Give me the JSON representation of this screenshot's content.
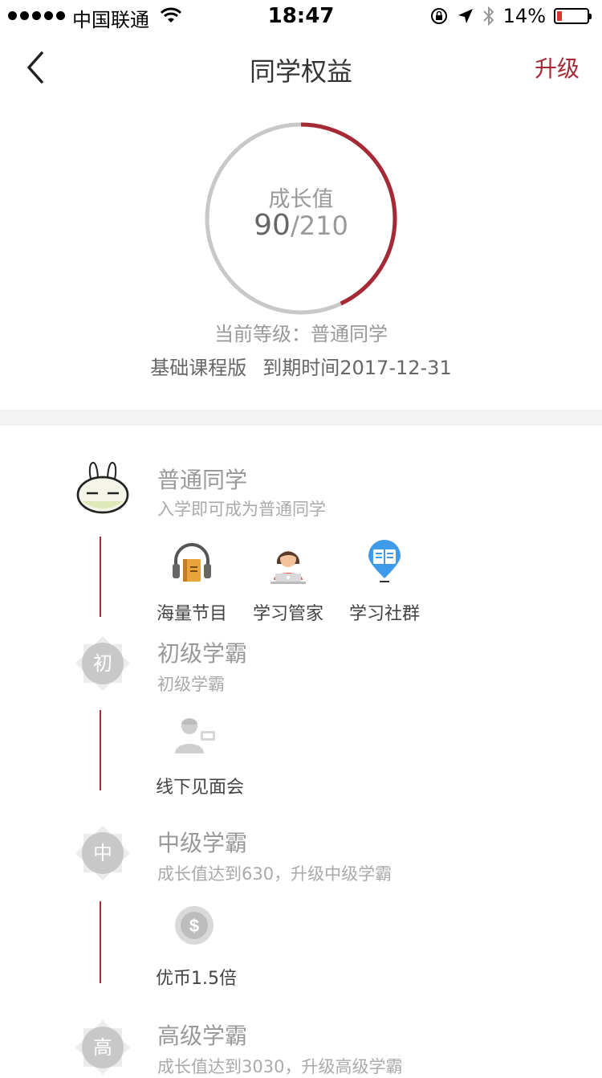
{
  "status_bar": {
    "carrier": "中国联通",
    "time": "18:47",
    "battery_percent": "14%",
    "battery_level": 0.14
  },
  "nav": {
    "title": "同学权益",
    "upgrade_label": "升级"
  },
  "progress": {
    "label": "成长值",
    "current": "90",
    "total": "/210",
    "fraction": 0.43,
    "accent_color": "#a52a35",
    "track_color": "#c8c8c8"
  },
  "current_level": "当前等级：普通同学",
  "plan": {
    "edition": "基础课程版",
    "expiry": "到期时间2017-12-31"
  },
  "tiers": [
    {
      "name": "普通同学",
      "desc": "入学即可成为普通同学",
      "badge_icon": "bunny-icon",
      "perks": [
        {
          "label": "海量节目",
          "icon": "headphones-book-icon"
        },
        {
          "label": "学习管家",
          "icon": "assistant-icon"
        },
        {
          "label": "学习社群",
          "icon": "community-book-icon"
        }
      ]
    },
    {
      "name": "初级学霸",
      "desc": "初级学霸",
      "badge_char": "初",
      "perks": [
        {
          "label": "线下见面会",
          "icon": "meetup-icon"
        }
      ]
    },
    {
      "name": "中级学霸",
      "desc": "成长值达到630，升级中级学霸",
      "badge_char": "中",
      "perks": [
        {
          "label": "优币1.5倍",
          "icon": "coin-icon"
        }
      ]
    },
    {
      "name": "高级学霸",
      "desc": "成长值达到3030，升级高级学霸",
      "badge_char": "高"
    }
  ]
}
